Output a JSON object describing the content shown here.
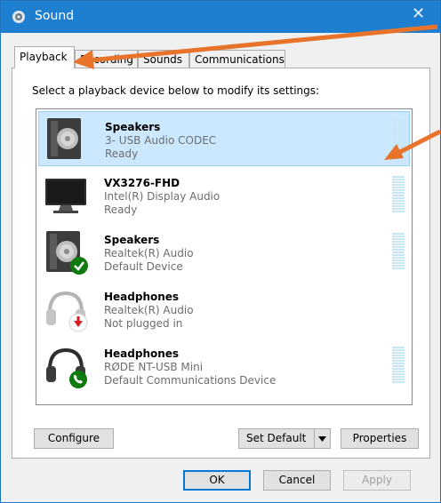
{
  "window": {
    "title": "Sound"
  },
  "tabs": [
    {
      "label": "Playback",
      "active": true
    },
    {
      "label": "Recording",
      "active": false
    },
    {
      "label": "Sounds",
      "active": false
    },
    {
      "label": "Communications",
      "active": false
    }
  ],
  "instruction": "Select a playback device below to modify its settings:",
  "devices": [
    {
      "name": "Speakers",
      "line1": "3- USB Audio CODEC",
      "line2": "Ready",
      "icon": "speaker-icon",
      "selected": true
    },
    {
      "name": "VX3276-FHD",
      "line1": "Intel(R) Display Audio",
      "line2": "Ready",
      "icon": "monitor-icon",
      "selected": false
    },
    {
      "name": "Speakers",
      "line1": "Realtek(R) Audio",
      "line2": "Default Device",
      "icon": "speaker-default-icon",
      "selected": false
    },
    {
      "name": "Headphones",
      "line1": "Realtek(R) Audio",
      "line2": "Not plugged in",
      "icon": "headphones-unplugged-icon",
      "selected": false
    },
    {
      "name": "Headphones",
      "line1": "RØDE NT-USB Mini",
      "line2": "Default Communications Device",
      "icon": "headphones-comm-icon",
      "selected": false
    }
  ],
  "buttons": {
    "configure": "Configure",
    "set_default": "Set Default",
    "properties": "Properties",
    "ok": "OK",
    "cancel": "Cancel",
    "apply": "Apply"
  },
  "colors": {
    "titlebar": "#1e7fd1",
    "selection": "#cce8ff",
    "default_check": "#0f7b0f",
    "unplugged_arrow": "#d81e1e",
    "annotation_arrow": "#e8742c"
  }
}
